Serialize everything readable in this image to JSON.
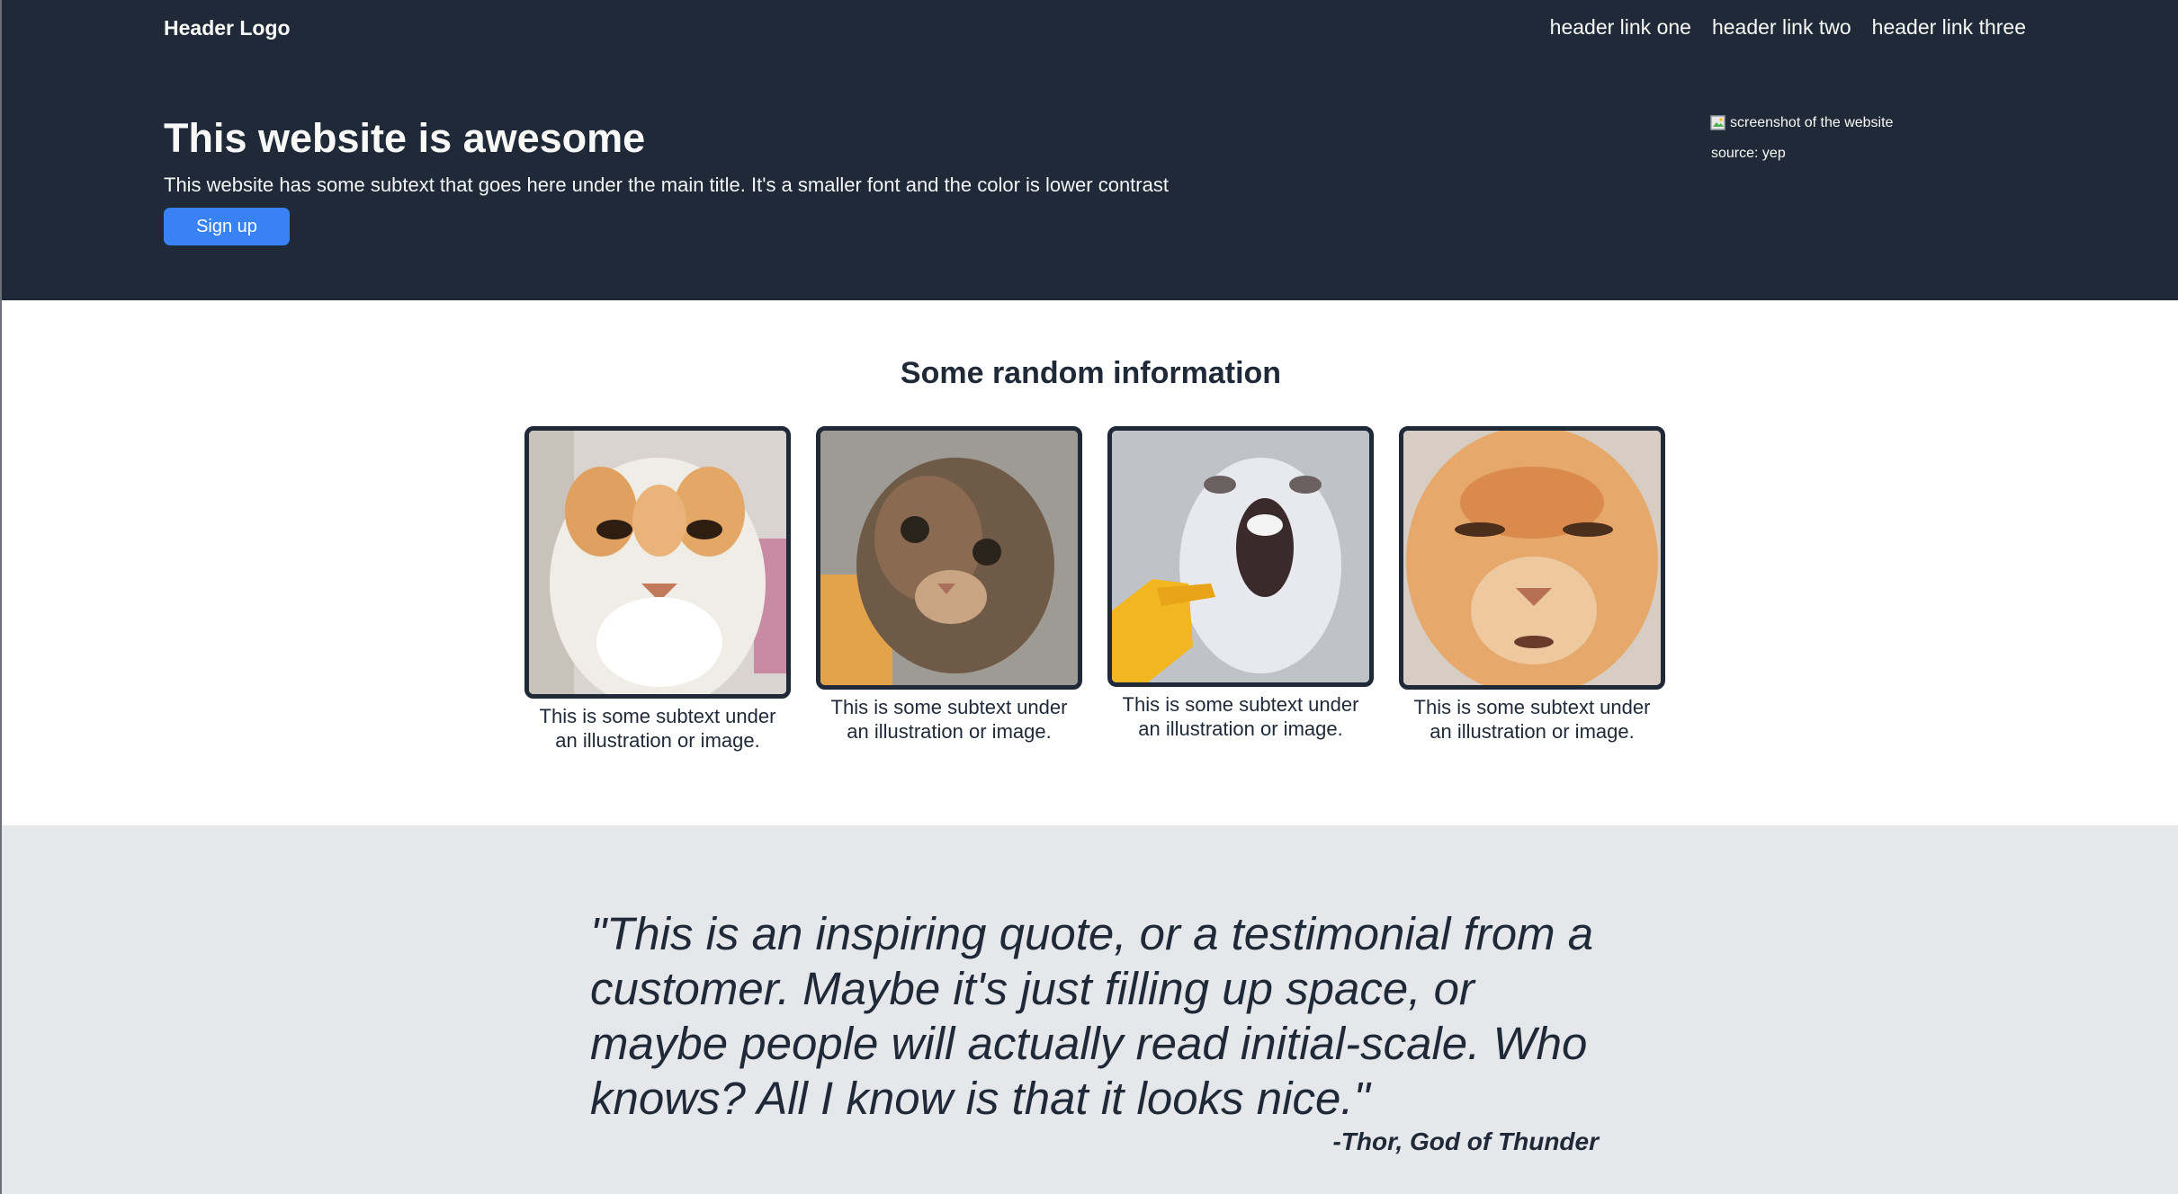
{
  "header": {
    "logo": "Header Logo",
    "links": [
      "header link one",
      "header link two",
      "header link three"
    ]
  },
  "hero": {
    "title": "This website is awesome",
    "subtitle": "This website has some subtext that goes here under the main title. It's a smaller font and the color is lower contrast",
    "signup_label": "Sign up",
    "image_alt": "screenshot of the website",
    "image_source": "source: yep"
  },
  "info": {
    "title": "Some random information",
    "cards": [
      {
        "caption": "This is some subtext under an illustration or image.",
        "image": "orange-white-cat-closeup"
      },
      {
        "caption": "This is some subtext under an illustration or image.",
        "image": "tabby-cat-looking-up"
      },
      {
        "caption": "This is some subtext under an illustration or image.",
        "image": "screaming-cat-with-pointing-hand-emoji"
      },
      {
        "caption": "This is some subtext under an illustration or image.",
        "image": "orange-cat-face-closeup"
      }
    ]
  },
  "quote": {
    "text": "\"This is an inspiring quote, or a testimonial from a customer. Maybe it's just filling up space, or maybe people will actually read initial-scale. Who knows? All I know is that it looks nice.\"",
    "author": "-Thor, God of Thunder"
  },
  "colors": {
    "dark": "#1f2937",
    "accent": "#3882f6",
    "light_bg": "#e5e7eb",
    "text_light": "#f9faf8"
  }
}
